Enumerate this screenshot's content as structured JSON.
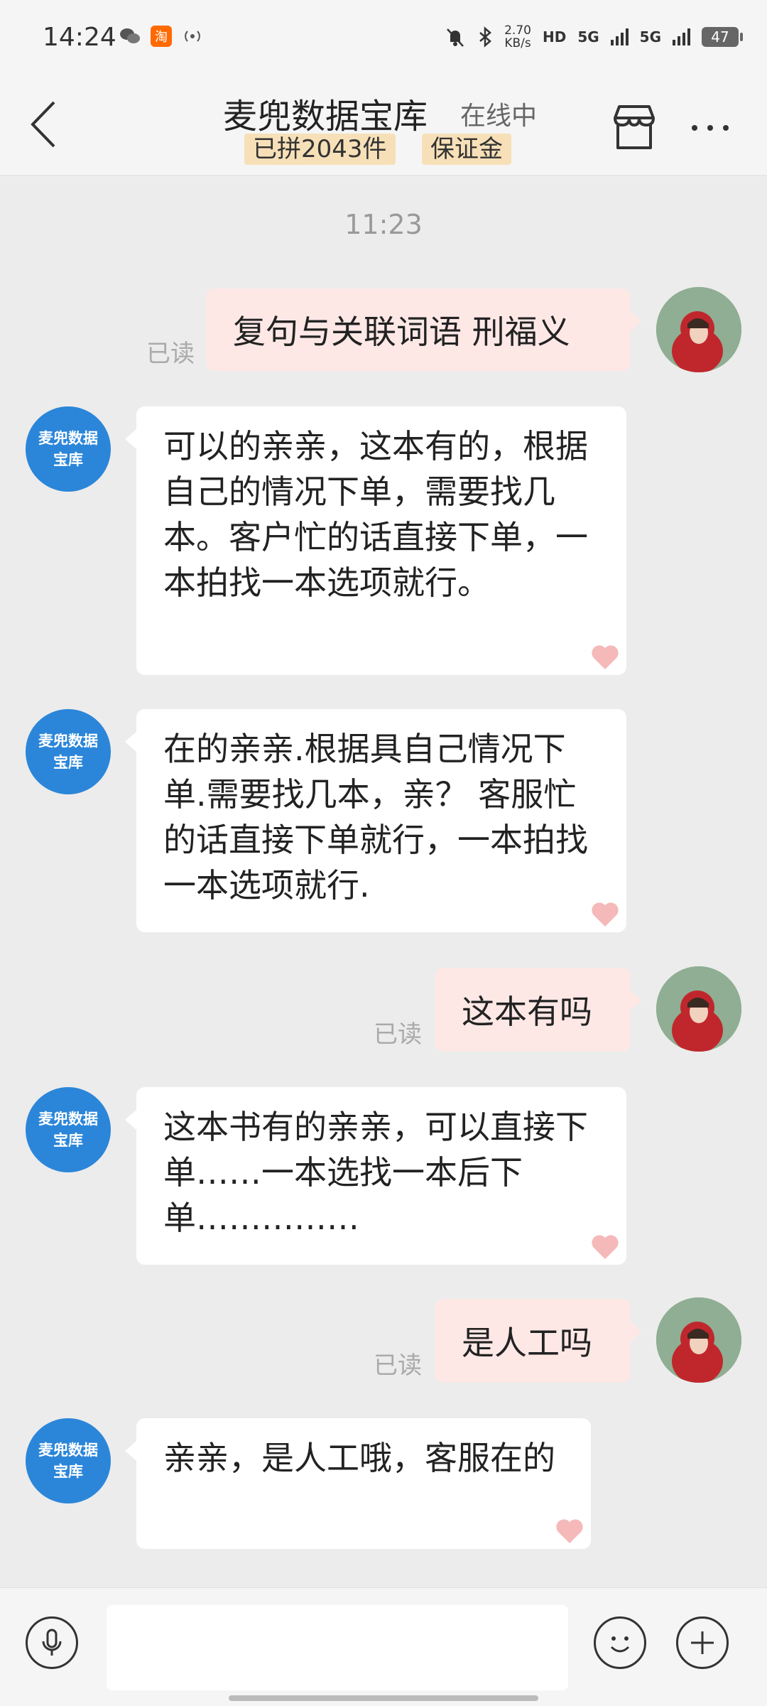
{
  "status_bar": {
    "time": "14:24",
    "speed_value": "2.70",
    "speed_unit": "KB/s",
    "hd_label": "HD",
    "net1": "5G",
    "net2": "5G",
    "battery": "47"
  },
  "header": {
    "shop_name": "麦兜数据宝库",
    "status": "在线中",
    "badge_sales": "已拼2043件",
    "badge_deposit": "保证金"
  },
  "chat": {
    "timestamp": "11:23",
    "shop_avatar_line1": "麦兜数据",
    "shop_avatar_line2": "宝库",
    "messages": [
      {
        "side": "out",
        "text": "复句与关联词语 刑福义",
        "read": "已读"
      },
      {
        "side": "in",
        "text": "可以的亲亲，这本有的，根据自己的情况下单，需要找几本。客户忙的话直接下单，一本拍找一本选项就行。"
      },
      {
        "side": "in",
        "text": "在的亲亲.根据具自己情况下单.需要找几本，亲？ 客服忙的话直接下单就行，一本拍找一本选项就行."
      },
      {
        "side": "out",
        "text": "这本有吗",
        "read": "已读"
      },
      {
        "side": "in",
        "text": "这本书有的亲亲，可以直接下单……一本选找一本后下单……………"
      },
      {
        "side": "out",
        "text": "是人工吗",
        "read": "已读"
      },
      {
        "side": "in",
        "text": "亲亲，是人工哦，客服在的"
      }
    ]
  },
  "input": {
    "placeholder": ""
  },
  "colors": {
    "accent": "#2b86d9",
    "out_bubble": "#fde8e6",
    "badge": "#f7e0b8"
  }
}
